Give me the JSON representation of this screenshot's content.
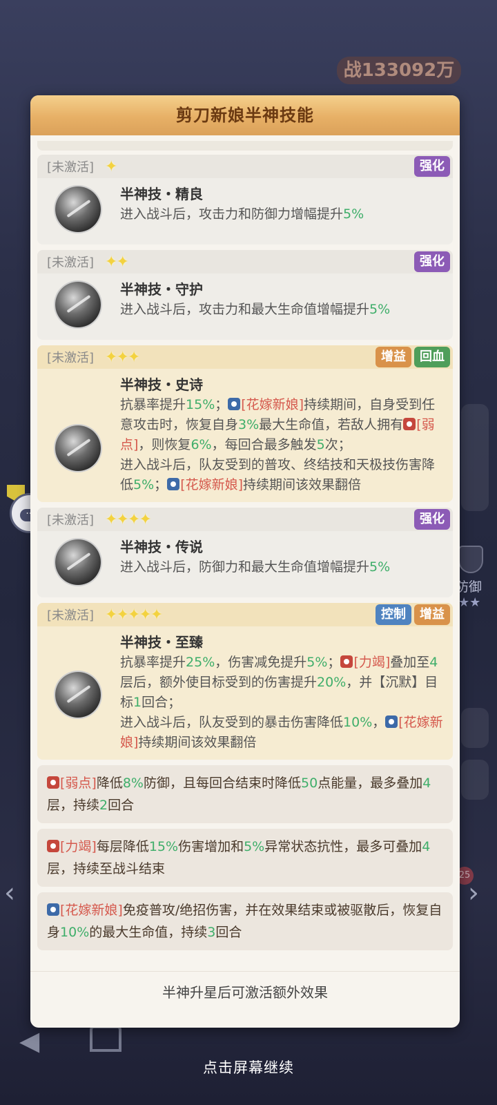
{
  "background": {
    "power_label": "战133092万",
    "defense_label": "防御",
    "badge_count": "25",
    "chat_count": "1",
    "continue_hint": "点击屏幕继续"
  },
  "panel": {
    "title": "剪刀新娘半神技能",
    "footer": "半神升星后可激活额外效果"
  },
  "skills": [
    {
      "status": "[未激活]",
      "stars": "✦",
      "tags": [
        "强化"
      ],
      "name": "半神技・精良",
      "desc_a": "进入战斗后，攻击力和防御力增幅提升",
      "desc_g": "5%"
    },
    {
      "status": "[未激活]",
      "stars": "✦✦",
      "tags": [
        "强化"
      ],
      "name": "半神技・守护",
      "desc_a": "进入战斗后，攻击力和最大生命值增幅提升",
      "desc_g": "5%"
    },
    {
      "status": "[未激活]",
      "stars": "✦✦✦",
      "tags": [
        "增益",
        "回血"
      ],
      "name": "半神技・史诗",
      "p1": "抗暴率提升",
      "p1g": "15%",
      "p2": "；",
      "kw_bride": "[花嫁新娘]",
      "p3": "持续期间，自身受到任意攻击时，恢复自身",
      "p3g": "3%",
      "p4": "最大生命值，若敌人拥有",
      "kw_weak": "[弱点]",
      "p5": "，则恢复",
      "p5g": "6%",
      "p6": "，每回合最多触发",
      "p6g": "5",
      "p7": "次；",
      "p8": "进入战斗后，队友受到的普攻、终结技和天极技伤害降低",
      "p8g": "5%",
      "p9": "；",
      "kw_bride2": "[花嫁新娘]",
      "p10": "持续期间该效果翻倍"
    },
    {
      "status": "[未激活]",
      "stars": "✦✦✦✦",
      "tags": [
        "强化"
      ],
      "name": "半神技・传说",
      "desc_a": "进入战斗后，防御力和最大生命值增幅提升",
      "desc_g": "5%"
    },
    {
      "status": "[未激活]",
      "stars": "✦✦✦✦✦",
      "tags": [
        "控制",
        "增益"
      ],
      "name": "半神技・至臻",
      "p1": "抗暴率提升",
      "p1g": "25%",
      "p2": "，伤害减免提升",
      "p2g": "5%",
      "p3": "；",
      "kw_exhaust": "[力竭]",
      "p4": "叠加至",
      "p4g": "4",
      "p5": "层后，额外使目标受到的伤害提升",
      "p5g": "20%",
      "p6": "，并【沉默】目标",
      "p6g": "1",
      "p7": "回合；",
      "p8": "进入战斗后，队友受到的暴击伤害降低",
      "p8g": "10%",
      "p9": "，",
      "kw_bride": "[花嫁新娘]",
      "p10": "持续期间该效果翻倍"
    }
  ],
  "glossary": [
    {
      "kw": "[弱点]",
      "t1": "降低",
      "g1": "8%",
      "t2": "防御，且每回合结束时降低",
      "g2": "50",
      "t3": "点能量，最多叠加",
      "g3": "4",
      "t4": "层，持续",
      "g4": "2",
      "t5": "回合"
    },
    {
      "kw": "[力竭]",
      "t1": "每层降低",
      "g1": "15%",
      "t2": "伤害增加和",
      "g2": "5%",
      "t3": "异常状态抗性，最多可叠加",
      "g3": "4",
      "t4": "层，持续至战斗结束"
    },
    {
      "kw": "[花嫁新娘]",
      "t1": "免疫普攻/绝招伤害，并在效果结束或被驱散后，恢复自身",
      "g1": "10%",
      "t2": "的最大生命值，持续",
      "g2": "3",
      "t3": "回合"
    }
  ],
  "colors": {
    "header_gold": "#e7b066",
    "tag_purple": "#8c5bb6",
    "tag_orange": "#d9924a",
    "tag_green": "#4f9e5a",
    "tag_blue": "#4f83c0",
    "value_green": "#3fae6a",
    "keyword_red": "#d5594d"
  }
}
